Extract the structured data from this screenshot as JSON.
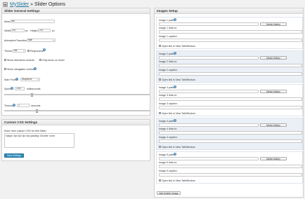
{
  "header": {
    "brand": "MySlider",
    "separator": " » ",
    "title": "Slider Options"
  },
  "general": {
    "title": "Slider General Settings",
    "alias_label": "Alias:",
    "alias_value": "abc",
    "width_label": "Width:",
    "width_value": "200",
    "px1": "px",
    "height_label": "Height:",
    "height_value": "200",
    "px2": "px",
    "anim_label": "Animation/Transition:",
    "anim_value": "fade",
    "theme_label": "Theme:",
    "theme_value": "bar",
    "responsive_label": "Responsive?",
    "dir_label": "Show directions controls",
    "hover_label": "Only show on hover",
    "nav_label": "Show navigation controls",
    "start_label": "Start From:",
    "start_value": "Sequence",
    "speed_label": "Speed:",
    "speed_value": "1000",
    "ms_label": "milliseconds",
    "timeout_label": "Timeout:",
    "timeout_value": "3",
    "sec_label": "seconds"
  },
  "css": {
    "title": "Custom CSS Settings",
    "hint": "Enter here custom CSS for this Slider:",
    "value": "margin: 0px 0px 0px 0px;padding: 0;border: none;",
    "save": "Save Settings"
  },
  "images": {
    "title": "Images Setup",
    "items": [
      {
        "path": "Image 1 path:",
        "link": "Image 1 links to:",
        "caption": "Image 1 caption:",
        "media": "Media Gallery",
        "newtab": "Open link in New Tab/Window"
      },
      {
        "path": "Image 2 path:",
        "link": "Image 2 links to:",
        "caption": "Image 2 caption:",
        "media": "Media Gallery",
        "newtab": "Open link in New Tab/Window"
      },
      {
        "path": "Image 3 path:",
        "link": "Image 3 links to:",
        "caption": "Image 3 caption:",
        "media": "Media Gallery",
        "newtab": "Open link in New Tab/Window"
      },
      {
        "path": "Image 4 path:",
        "link": "Image 4 links to:",
        "caption": "Image 4 caption:",
        "media": "Media Gallery",
        "newtab": "Open link in New Tab/Window"
      },
      {
        "path": "Image 5 path:",
        "link": "Image 5 links to:",
        "caption": "Image 5 caption:",
        "media": "Media Gallery",
        "newtab": "Open link in New Tab/Window"
      }
    ],
    "add": "Add Another Image"
  }
}
